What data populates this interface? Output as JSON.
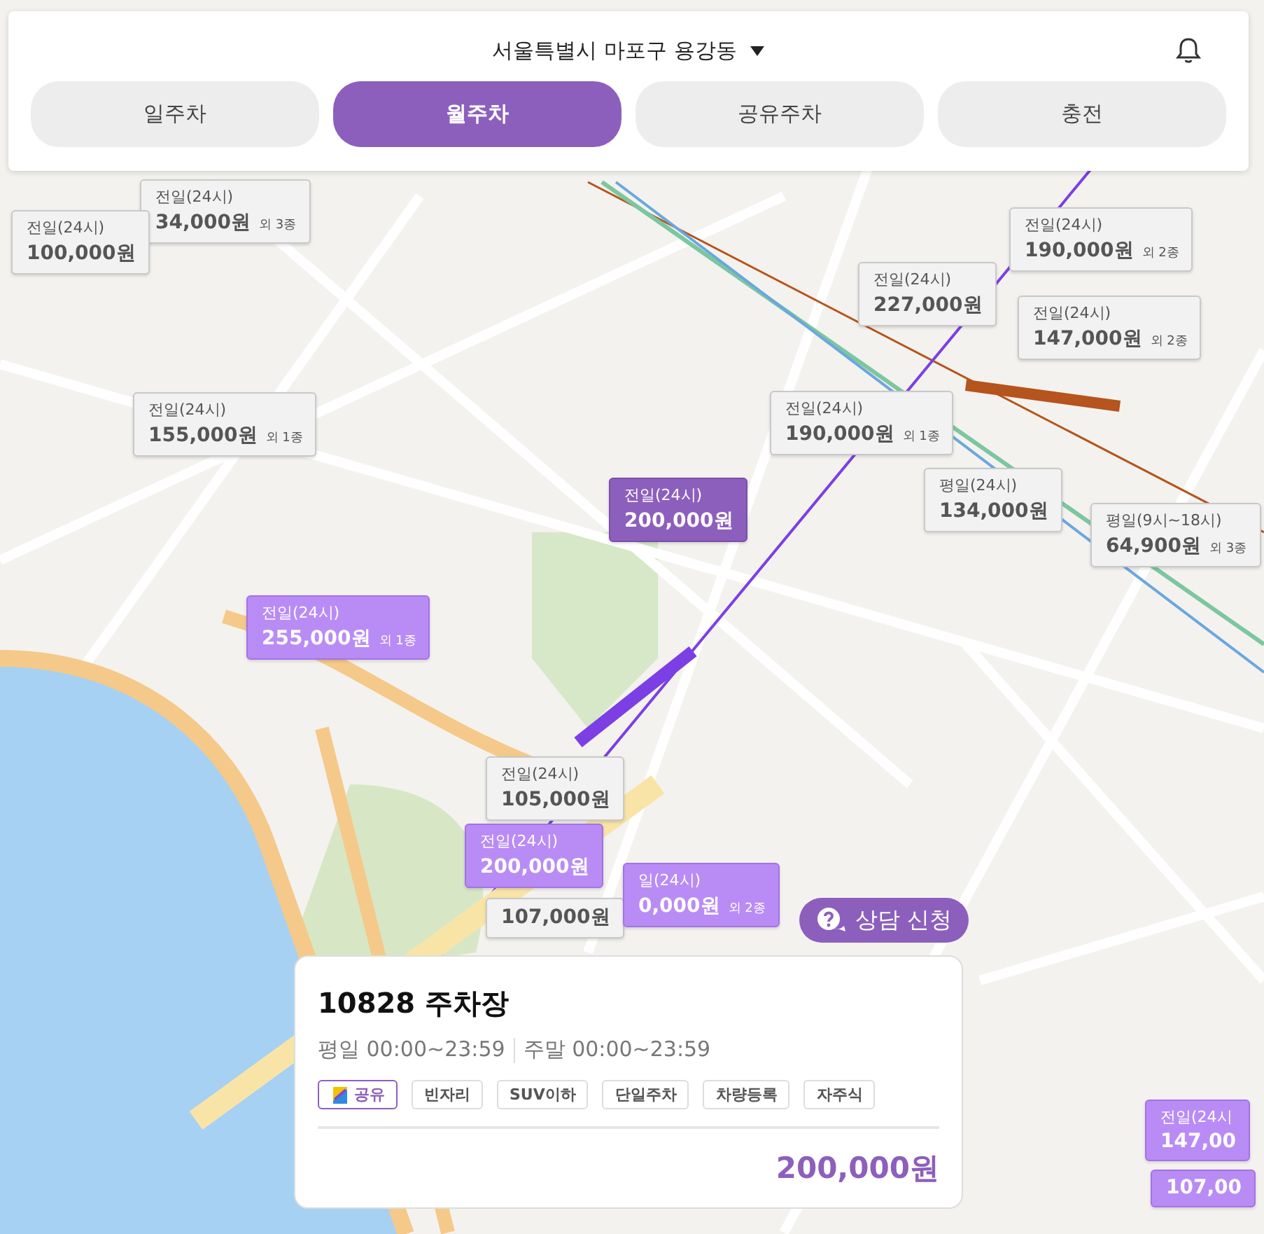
{
  "header": {
    "location": "서울특별시 마포구 용강동"
  },
  "tabs": [
    {
      "label": "일주차",
      "selected": false
    },
    {
      "label": "월주차",
      "selected": true
    },
    {
      "label": "공유주차",
      "selected": false
    },
    {
      "label": "충전",
      "selected": false
    }
  ],
  "map": {
    "pins": [
      {
        "label": "전일(24시)",
        "price": "34,000원",
        "extra": "외 3종",
        "kind": "regular",
        "selected": false
      },
      {
        "label": "전일(24시)",
        "price": "100,000원",
        "kind": "regular",
        "selected": false
      },
      {
        "label": "전일(24시)",
        "price": "155,000원",
        "extra": "외 1종",
        "kind": "regular",
        "selected": false
      },
      {
        "label": "전일(24시)",
        "price": "255,000원",
        "extra": "외 1종",
        "kind": "shared",
        "selected": false
      },
      {
        "label": "전일(24시)",
        "price": "200,000원",
        "kind": "shared",
        "selected": true
      },
      {
        "label": "전일(24시)",
        "price": "227,000원",
        "kind": "regular",
        "selected": false
      },
      {
        "label": "전일(24시)",
        "price": "190,000원",
        "extra": "외 2종",
        "kind": "regular",
        "selected": false
      },
      {
        "label": "전일(24시)",
        "price": "147,000원",
        "extra": "외 2종",
        "kind": "regular",
        "selected": false
      },
      {
        "label": "전일(24시)",
        "price": "190,000원",
        "extra": "외 1종",
        "kind": "regular",
        "selected": false
      },
      {
        "label": "평일(24시)",
        "price": "134,000원",
        "kind": "regular",
        "selected": false
      },
      {
        "label": "평일(9시~18시)",
        "price": "64,900원",
        "extra": "외 3종",
        "kind": "regular",
        "selected": false
      },
      {
        "label": "전일(24시)",
        "price": "105,000원",
        "kind": "regular",
        "selected": false
      },
      {
        "price": "107,000원",
        "kind": "regular",
        "selected": false
      },
      {
        "label": "일(24시)",
        "price": "0,000원",
        "extra": "외 2종",
        "kind": "shared",
        "selected": false
      },
      {
        "label": "전일(24시)",
        "price": "200,000원",
        "kind": "shared",
        "selected": false
      },
      {
        "label": "전일(24시",
        "price": "147,00",
        "kind": "shared",
        "selected": false
      },
      {
        "price": "107,00",
        "kind": "shared",
        "selected": false
      }
    ]
  },
  "consult_button": {
    "label": "상담 신청"
  },
  "parking_card": {
    "title": "10828 주차장",
    "weekday": "평일 00:00~23:59",
    "weekend": "주말 00:00~23:59",
    "tags": [
      {
        "label": "공유",
        "highlighted": true
      },
      {
        "label": "빈자리",
        "highlighted": false
      },
      {
        "label": "SUV이하",
        "highlighted": false
      },
      {
        "label": "단일주차",
        "highlighted": false
      },
      {
        "label": "차량등록",
        "highlighted": false
      },
      {
        "label": "자주식",
        "highlighted": false
      }
    ],
    "price": "200,000원"
  }
}
